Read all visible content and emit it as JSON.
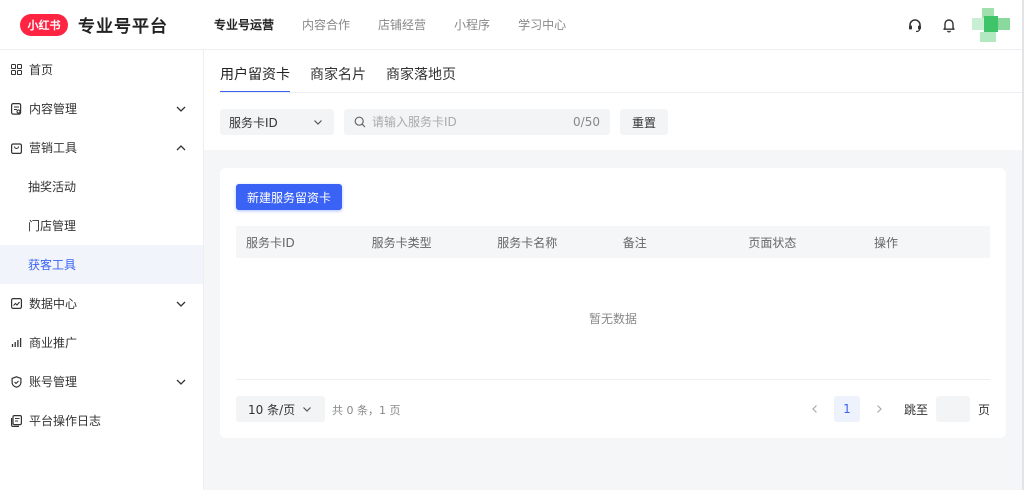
{
  "header": {
    "logo_text": "小红书",
    "platform_name": "专业号平台",
    "nav": [
      {
        "label": "专业号运营",
        "active": true
      },
      {
        "label": "内容合作",
        "active": false
      },
      {
        "label": "店铺经营",
        "active": false
      },
      {
        "label": "小程序",
        "active": false
      },
      {
        "label": "学习中心",
        "active": false
      }
    ],
    "icons": [
      "headset-icon",
      "bell-icon"
    ],
    "brand_color": "#ff2442"
  },
  "sidebar": {
    "items": [
      {
        "label": "首页",
        "icon": "grid-icon",
        "expandable": false
      },
      {
        "label": "内容管理",
        "icon": "document-icon",
        "expandable": true,
        "expanded": false
      },
      {
        "label": "营销工具",
        "icon": "bag-icon",
        "expandable": true,
        "expanded": true
      },
      {
        "label": "抽奖活动",
        "sub": true
      },
      {
        "label": "门店管理",
        "sub": true
      },
      {
        "label": "获客工具",
        "sub": true,
        "selected": true
      },
      {
        "label": "数据中心",
        "icon": "chart-icon",
        "expandable": true,
        "expanded": false
      },
      {
        "label": "商业推广",
        "icon": "bars-icon",
        "expandable": false
      },
      {
        "label": "账号管理",
        "icon": "shield-icon",
        "expandable": true,
        "expanded": false
      },
      {
        "label": "平台操作日志",
        "icon": "log-icon",
        "expandable": false
      }
    ]
  },
  "main": {
    "tabs": [
      {
        "label": "用户留资卡",
        "active": true
      },
      {
        "label": "商家名片",
        "active": false
      },
      {
        "label": "商家落地页",
        "active": false
      }
    ],
    "filter": {
      "select_value": "服务卡ID",
      "search_placeholder": "请输入服务卡ID",
      "search_value": "",
      "search_counter": "0/50",
      "reset_label": "重置"
    },
    "create_button_label": "新建服务留资卡",
    "table": {
      "columns": [
        "服务卡ID",
        "服务卡类型",
        "服务卡名称",
        "备注",
        "页面状态",
        "操作"
      ],
      "rows": [],
      "empty_text": "暂无数据"
    },
    "pagination": {
      "page_size_label": "10 条/页",
      "total_text": "共 0 条，1 页",
      "current_page": "1",
      "jump_label": "跳至",
      "jump_value": "",
      "page_unit": "页"
    }
  },
  "accent_color": "#3a63f5"
}
